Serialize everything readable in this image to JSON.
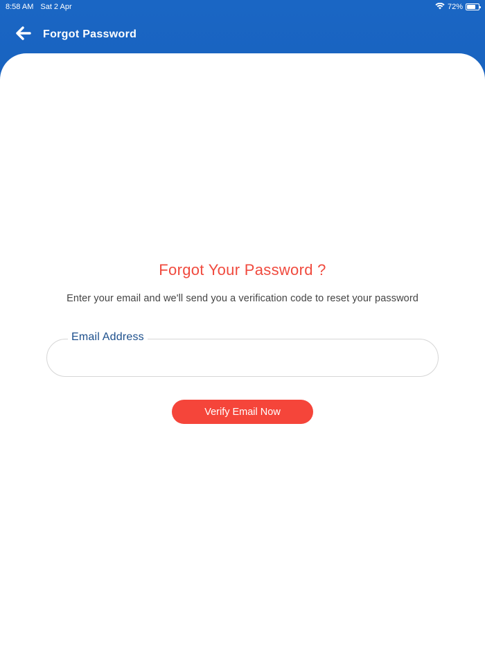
{
  "status_bar": {
    "time": "8:58 AM",
    "date": "Sat 2 Apr",
    "battery": "72%",
    "battery_level": 0.72,
    "wifi_icon": "wifi-icon",
    "battery_icon": "battery-icon"
  },
  "header": {
    "back_icon": "arrow-left-icon",
    "title": "Forgot Password"
  },
  "form": {
    "heading": "Forgot Your Password ?",
    "subtext": "Enter your email and we'll send you a verification code to reset your password",
    "email_label": "Email Address",
    "email_value": "",
    "submit_label": "Verify Email Now"
  },
  "colors": {
    "header_blue": "#1a66c4",
    "accent_red": "#f5453a",
    "label_blue": "#1c4f8c"
  }
}
